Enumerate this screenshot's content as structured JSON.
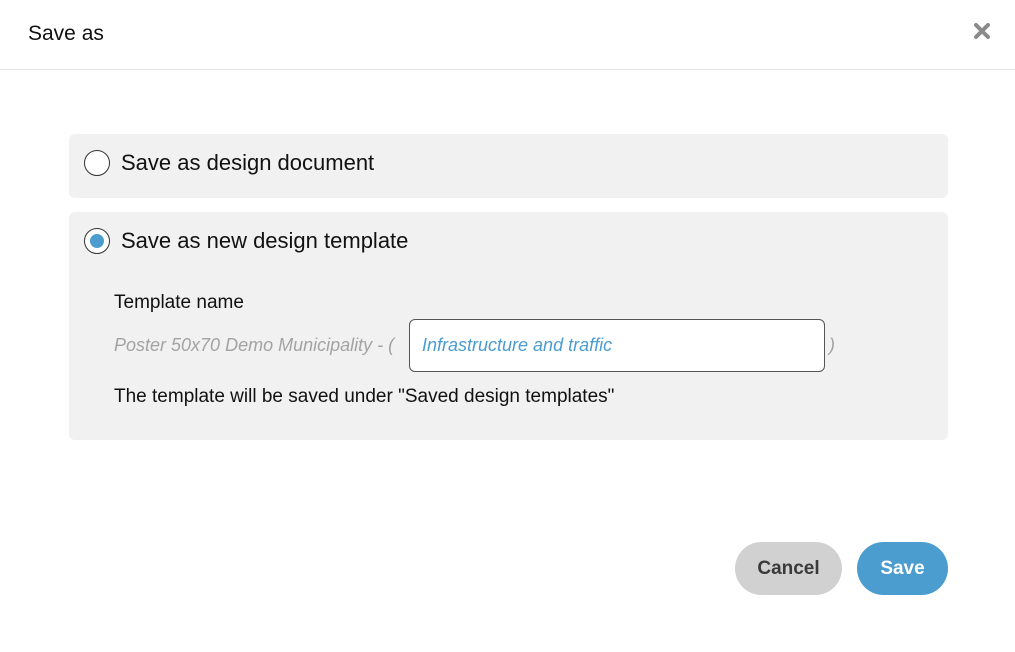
{
  "dialog": {
    "title": "Save as",
    "close_icon": "close-icon"
  },
  "options": {
    "design_document": {
      "label": "Save as design document",
      "selected": false
    },
    "design_template": {
      "label": "Save as new design template",
      "selected": true,
      "template_name_label": "Template name",
      "name_prefix": "Poster 50x70 Demo Municipality - (",
      "name_value": "Infrastructure and traffic",
      "name_suffix": ")",
      "note": "The template will be saved under \"Saved design templates\""
    }
  },
  "buttons": {
    "cancel": "Cancel",
    "save": "Save"
  },
  "colors": {
    "accent": "#4b9ccf",
    "option_background": "#f1f1f1",
    "cancel_background": "#d1d1d1"
  }
}
